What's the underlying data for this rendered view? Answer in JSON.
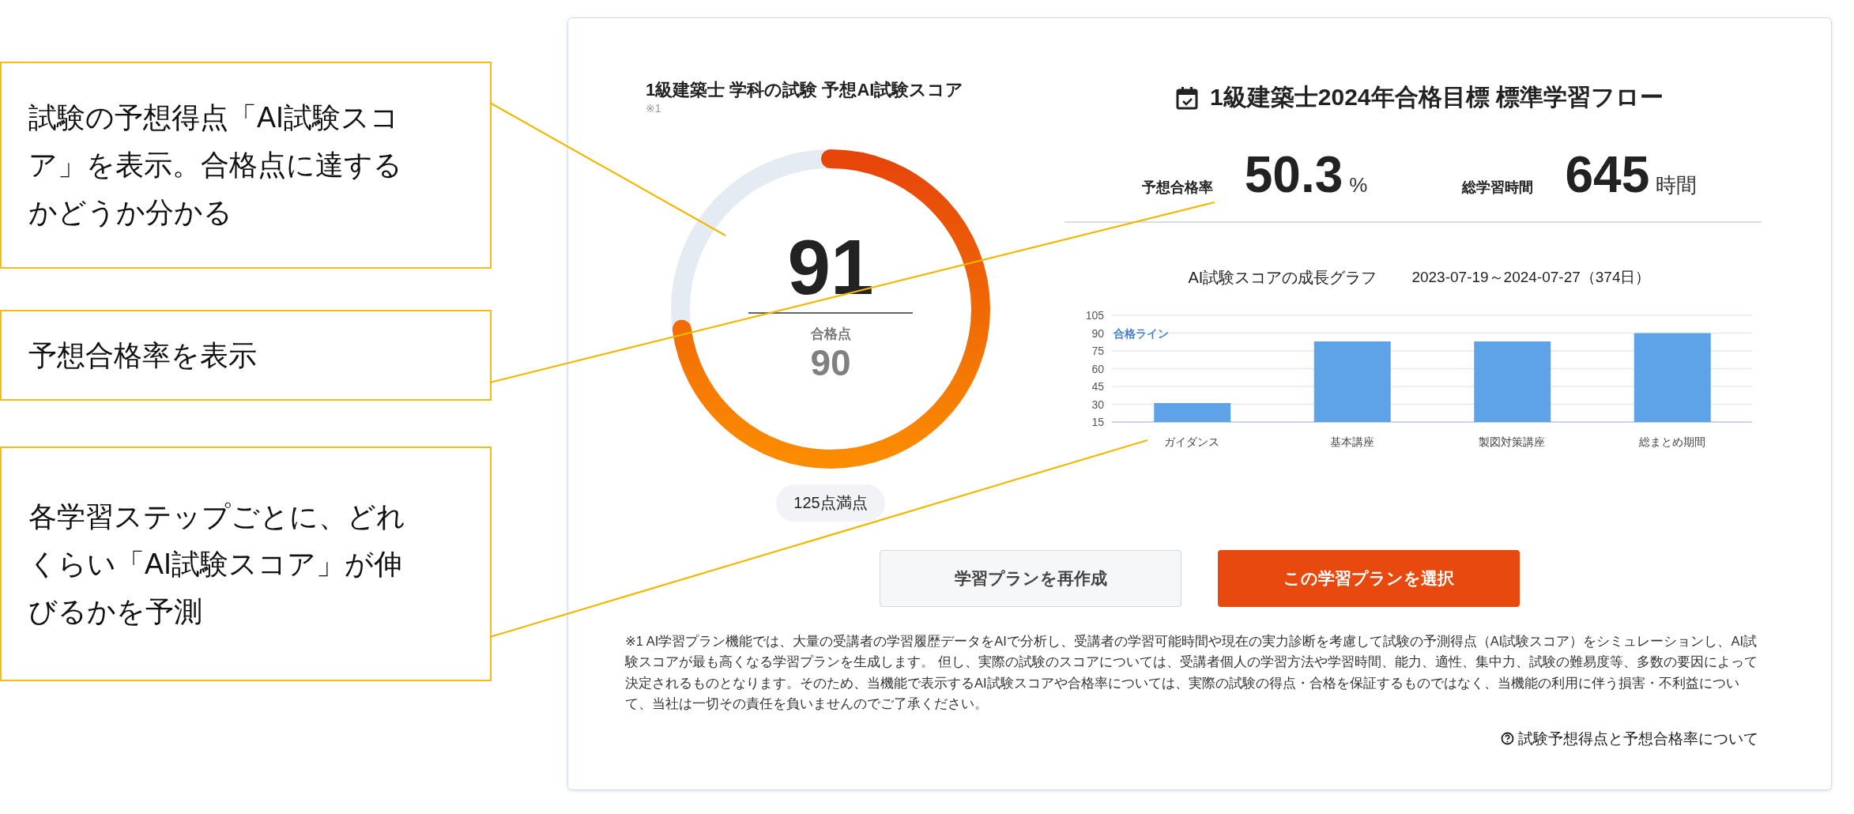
{
  "callouts": [
    {
      "lines": [
        "試験の予想得点「AI試験スコ",
        "ア」を表示。合格点に達する",
        "かどうか分かる"
      ]
    },
    {
      "lines": [
        "予想合格率を表示"
      ]
    },
    {
      "lines": [
        "各学習ステップごとに、どれ",
        "くらい「AI試験スコア」が伸",
        "びるかを予測"
      ]
    }
  ],
  "score_panel": {
    "title": "1級建築士 学科の試験 予想AI試験スコア",
    "note": "※1",
    "score": "91",
    "level": 0.728,
    "pass_label": "合格点",
    "pass_score": "90",
    "max_label": "125点満点"
  },
  "plan_panel": {
    "title": "1級建築士2024年合格目標 標準学習フロー",
    "stats": [
      {
        "label": "予想合格率",
        "value": "50.3",
        "unit": "%"
      },
      {
        "label": "総学習時間",
        "value": "645",
        "unit": "時間"
      }
    ],
    "period": "2023-07-19～2024-07-27（374日）",
    "chart_data": {
      "type": "bar",
      "title": "AI試験スコアの成長グラフ",
      "categories": [
        "ガイダンス",
        "基本講座",
        "製図対策講座",
        "総まとめ期間"
      ],
      "series": [
        {
          "color": "#5ea3e8",
          "values": [
            31,
            83,
            83,
            90
          ]
        }
      ],
      "ylim": [
        15,
        105
      ],
      "yticks": [
        15,
        30,
        45,
        60,
        75,
        90,
        105
      ],
      "grid": true
    },
    "pass_line_label": "合格ライン"
  },
  "buttons": [
    {
      "label": "学習プランを再作成",
      "kind": "secondary"
    },
    {
      "label": "この学習プランを選択",
      "kind": "primary"
    }
  ],
  "footnote": "※1 AI学習プラン機能では、大量の受講者の学習履歴データをAIで分析し、受講者の学習可能時間や現在の実力診断を考慮して試験の予測得点（AI試験スコア）をシミュレーションし、AI試験スコアが最も高くなる学習プランを生成します。 但し、実際の試験のスコアについては、受講者個人の学習方法や学習時間、能力、適性、集中力、試験の難易度等、多数の要因によって決定されるものとなります。そのため、当機能で表示するAI試験スコアや合格率については、実際の試験の得点・合格を保証するものではなく、当機能の利用に伴う損害・不利益について、当社は一切その責任を負いませんのでご了承ください。",
  "help_link": "試験予想得点と予想合格率について"
}
